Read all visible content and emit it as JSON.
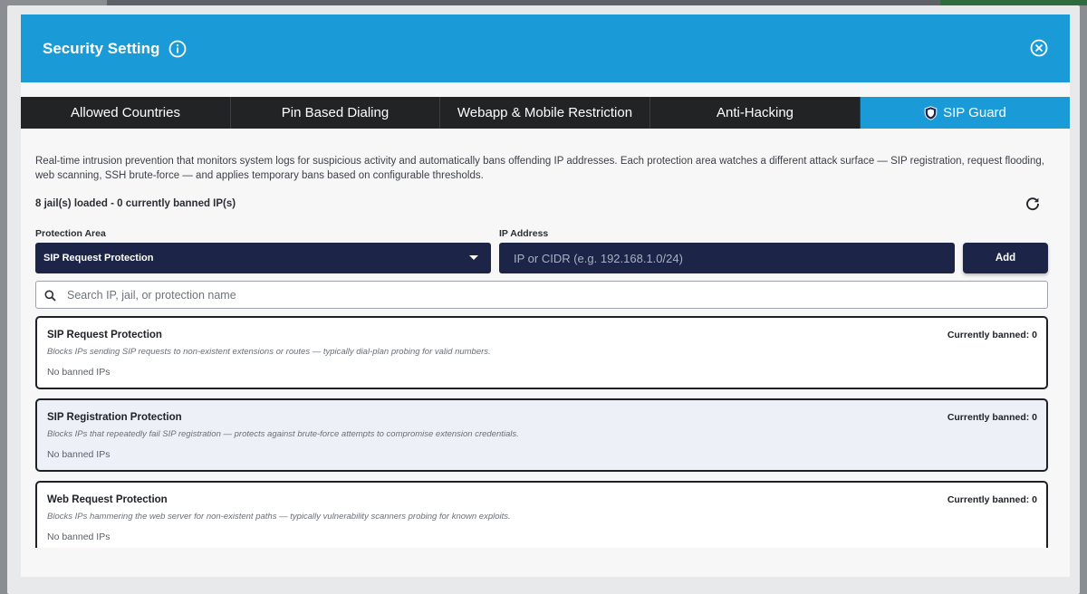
{
  "modal": {
    "title": "Security Setting",
    "icons": {
      "info": "info-icon",
      "close": "close-icon"
    }
  },
  "tabs": [
    {
      "label": "Allowed Countries",
      "active": false
    },
    {
      "label": "Pin Based Dialing",
      "active": false
    },
    {
      "label": "Webapp & Mobile Restriction",
      "active": false
    },
    {
      "label": "Anti-Hacking",
      "active": false
    },
    {
      "label": "SIP Guard",
      "active": true,
      "icon": "shield-icon"
    }
  ],
  "description": "Real-time intrusion prevention that monitors system logs for suspicious activity and automatically bans offending IP addresses. Each protection area watches a different attack surface — SIP registration, request flooding, web scanning, SSH brute-force — and applies temporary bans based on configurable thresholds.",
  "status_text": "8 jail(s) loaded - 0 currently banned IP(s)",
  "form": {
    "protection_area_label": "Protection Area",
    "protection_area_value": "SIP Request Protection",
    "ip_label": "IP Address",
    "ip_value": "",
    "ip_placeholder": "IP or CIDR (e.g. 192.168.1.0/24)",
    "add_label": "Add"
  },
  "search": {
    "value": "",
    "placeholder": "Search IP, jail, or protection name"
  },
  "jails": [
    {
      "title": "SIP Request Protection",
      "banned": "Currently banned: 0",
      "desc": "Blocks IPs sending SIP requests to non-existent extensions or routes — typically dial-plan probing for valid numbers.",
      "empty": "No banned IPs"
    },
    {
      "title": "SIP Registration Protection",
      "banned": "Currently banned: 0",
      "desc": "Blocks IPs that repeatedly fail SIP registration — protects against brute-force attempts to compromise extension credentials.",
      "empty": "No banned IPs"
    },
    {
      "title": "Web Request Protection",
      "banned": "Currently banned: 0",
      "desc": "Blocks IPs hammering the web server for non-existent paths — typically vulnerability scanners probing for known exploits.",
      "empty": "No banned IPs"
    }
  ],
  "colors": {
    "header": "#1a9bd8",
    "tab_dark": "#212325",
    "navy": "#1c2547"
  }
}
